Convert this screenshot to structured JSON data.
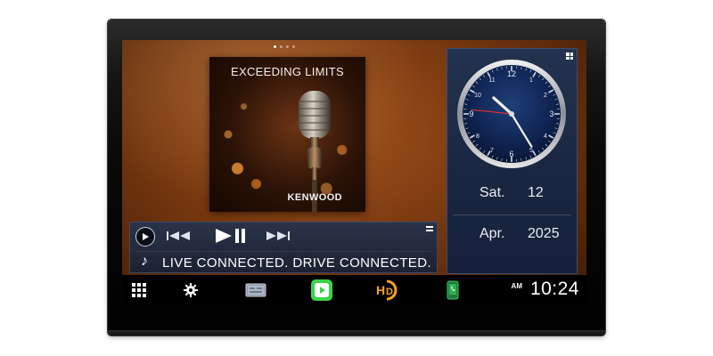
{
  "album": {
    "title": "EXCEEDING LIMITS",
    "brand": "KENWOOD"
  },
  "player": {
    "track_text": "LIVE CONNECTED. DRIVE CONNECTED.",
    "icons": [
      "source-play-icon",
      "previous-track-icon",
      "play-pause-icon",
      "next-track-icon",
      "music-note-icon",
      "menu-icon"
    ]
  },
  "clock_widget": {
    "weekday": "Sat.",
    "day": "12",
    "month": "Apr.",
    "year": "2025",
    "analog_time": {
      "hour": 10,
      "minute": 24,
      "second": 46
    }
  },
  "status": {
    "ampm": "AM",
    "time": "10:24"
  },
  "bottom_bar": {
    "icons": [
      "apps-grid-icon",
      "settings-gear-icon",
      "screen-mirror-icon",
      "carplay-icon",
      "hd-radio-icon",
      "phone-icon"
    ]
  },
  "colors": {
    "background_warm": "#a0531d",
    "panel_blue": "#1b2233",
    "carplay_green": "#3ad34a",
    "hd_orange": "#f5a21a",
    "clock_second_hand": "#e03030"
  }
}
